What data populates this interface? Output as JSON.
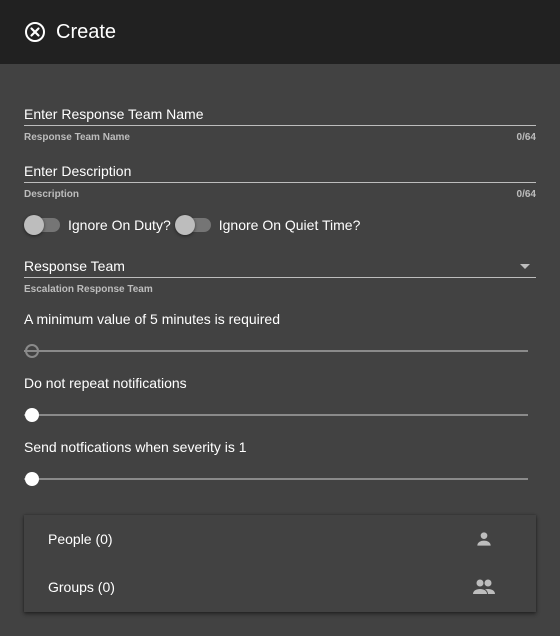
{
  "header": {
    "title": "Create",
    "close_icon": "close-circle-icon"
  },
  "name_field": {
    "placeholder": "Enter Response Team Name",
    "value": "",
    "hint": "Response Team Name",
    "counter": "0/64"
  },
  "description_field": {
    "placeholder": "Enter Description",
    "value": "",
    "hint": "Description",
    "counter": "0/64"
  },
  "toggles": [
    {
      "label": "Ignore On Duty?",
      "checked": false
    },
    {
      "label": "Ignore On Quiet Time?",
      "checked": false
    }
  ],
  "escalation_select": {
    "selected": "Response Team",
    "hint": "Escalation Response Team"
  },
  "sliders": [
    {
      "label": "A minimum value of 5 minutes is required",
      "value_fraction": 0,
      "state": "inactive"
    },
    {
      "label": "Do not repeat notifications",
      "value_fraction": 0,
      "state": "active"
    },
    {
      "label": "Send notfications when severity is 1",
      "value_fraction": 0,
      "state": "active"
    }
  ],
  "members": {
    "items": [
      {
        "label": "People (0)",
        "icon": "person-icon"
      },
      {
        "label": "Groups (0)",
        "icon": "group-icon"
      }
    ]
  },
  "colors": {
    "header_bg": "#212121",
    "page_bg": "#424242",
    "text": "#ffffff",
    "hint_text": "#bdbdbd",
    "toggle_track": "#757575",
    "toggle_thumb": "#bdbdbd"
  }
}
